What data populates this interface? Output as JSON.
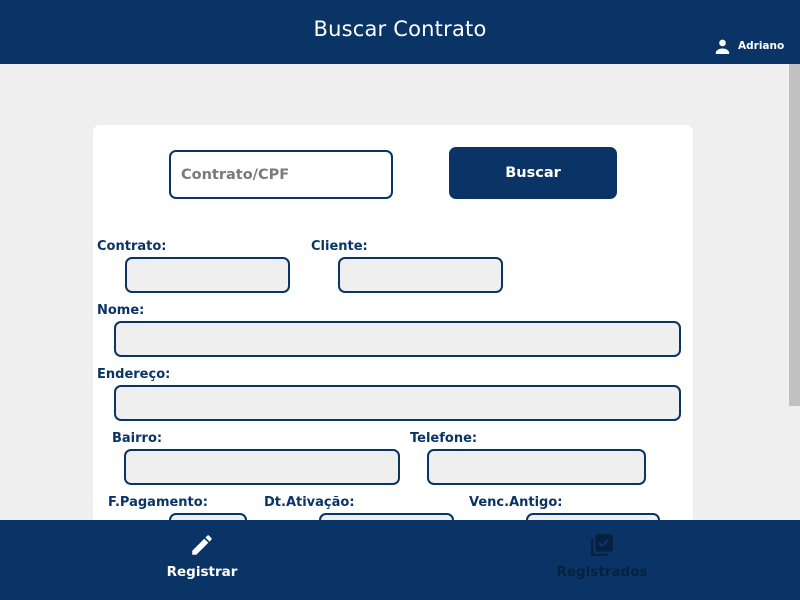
{
  "header": {
    "title": "Buscar Contrato",
    "user_icon": "person-icon",
    "user_name": "Adriano"
  },
  "search": {
    "placeholder": "Contrato/CPF",
    "value": "",
    "button_label": "Buscar"
  },
  "form": {
    "contrato_label": "Contrato:",
    "cliente_label": "Cliente:",
    "nome_label": "Nome:",
    "endereco_label": "Endereço:",
    "bairro_label": "Bairro:",
    "telefone_label": "Telefone:",
    "pagamento_label": "F.Pagamento:",
    "ativacao_label": "Dt.Ativação:",
    "vencimento_label": "Venc.Antigo:"
  },
  "bottom_nav": {
    "registrar": {
      "label": "Registrar",
      "icon": "pencil-icon"
    },
    "registrados": {
      "label": "Registrados",
      "icon": "checklist-icon"
    }
  },
  "colors": {
    "primary": "#0b3466",
    "background": "#efefef",
    "card": "#ffffff",
    "field": "#efefef"
  }
}
